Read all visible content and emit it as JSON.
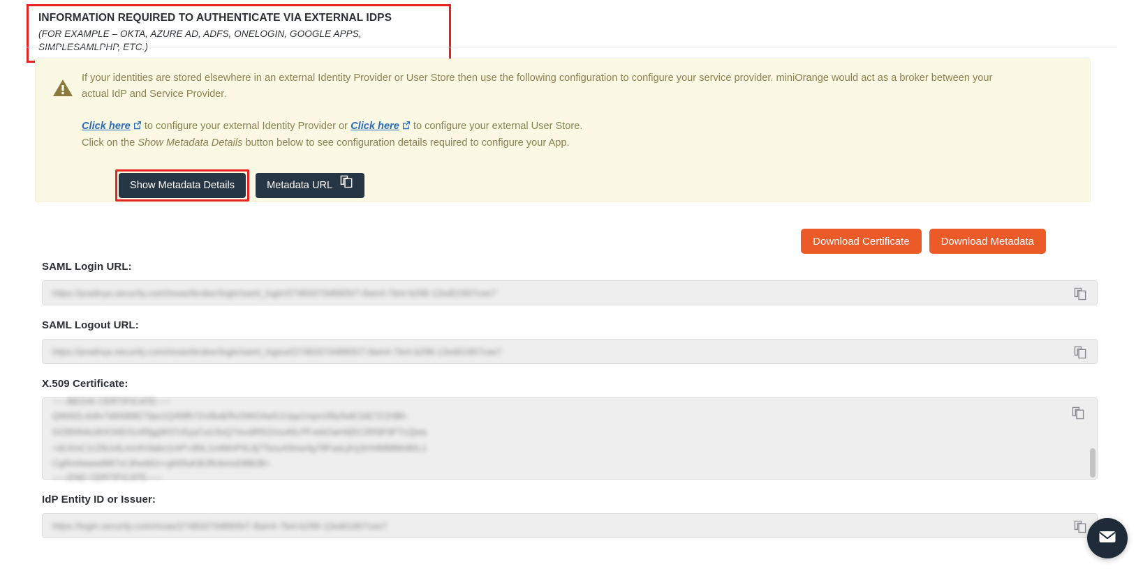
{
  "header": {
    "title": "INFORMATION REQUIRED TO AUTHENTICATE VIA EXTERNAL IDPS",
    "subtitle": "(FOR EXAMPLE – OKTA, AZURE AD, ADFS, ONELOGIN, GOOGLE APPS, SIMPLESAMLPHP, ETC.)"
  },
  "alert": {
    "icon": "warning-triangle-icon",
    "paragraph": "If your identities are stored elsewhere in an external Identity Provider or User Store then use the following configuration to configure your service provider. miniOrange would act as a broker between your actual IdP and Service Provider.",
    "link1_text": "Click here",
    "link1_after": " to configure your external Identity Provider or ",
    "link2_text": "Click here",
    "link2_after": " to configure your external User Store.",
    "line2_before": "Click on the ",
    "line2_emphasis": "Show Metadata Details",
    "line2_after": " button below to see configuration details required to configure your App.",
    "buttons": {
      "show_metadata": "Show Metadata Details",
      "metadata_url": "Metadata URL"
    }
  },
  "downloads": {
    "certificate": "Download Certificate",
    "metadata": "Download Metadata"
  },
  "fields": [
    {
      "label": "SAML Login URL:",
      "value": "https://pradnya.security.com/moas/broker/login/saml_login/2748337348905/7-8am4-7bnt-b298-12ed01907cee7",
      "type": "input",
      "copy_icon": "copy-icon"
    },
    {
      "label": "SAML Logout URL:",
      "value": "https://pradnya.security.com/moas/broker/login/saml_logout/2748337348905/7-8am4-7bnt-b298-12ed01907cee7",
      "type": "input",
      "copy_icon": "copy-icon"
    },
    {
      "label": "X.509 Certificate:",
      "type": "textarea",
      "copy_icon": "copy-icon",
      "lines": [
        "-----BEGIN CERTIFICATE-----",
        "QWADL4s8v7d65t89E70ps1Q4Mfh72v0kaEfhz5WG4wG1Upp1mpn1f8y5wE1bE7Z1HBh",
        "GO8NN4o30X34E01nRfggW37o5yyCuU3xQ7mvdRf2Zmu40LPFvekOaH4j5C2Rf3F9FTn2jwa",
        "+dcXmC1rZ9Lk4Lmn4Vdakn1mP+dNL1o4MnP0L9j7Tsnu43mw4g78FaaLjk1j3rH4MMMn80L1",
        "CgRm9aawd987vL5hw9Gn+gN5fuKl8JRnkmoD8B2B+",
        "-----END CERTIFICATE-----"
      ]
    },
    {
      "label": "IdP Entity ID or Issuer:",
      "value": "https://login.security.com/moas/2748337348905/7-8am4-7bnt-b298-12ed01907cee7",
      "type": "input",
      "copy_icon": "copy-icon"
    }
  ],
  "chat_widget": {
    "icon": "envelope-icon"
  },
  "colors": {
    "annotation_red": "#e8231f",
    "alert_bg": "#fbf8e3",
    "alert_text": "#8a8152",
    "link_blue": "#2a6ebb",
    "dark_button": "#263645",
    "orange_button": "#eb5a27",
    "field_bg": "#eeeeee"
  }
}
